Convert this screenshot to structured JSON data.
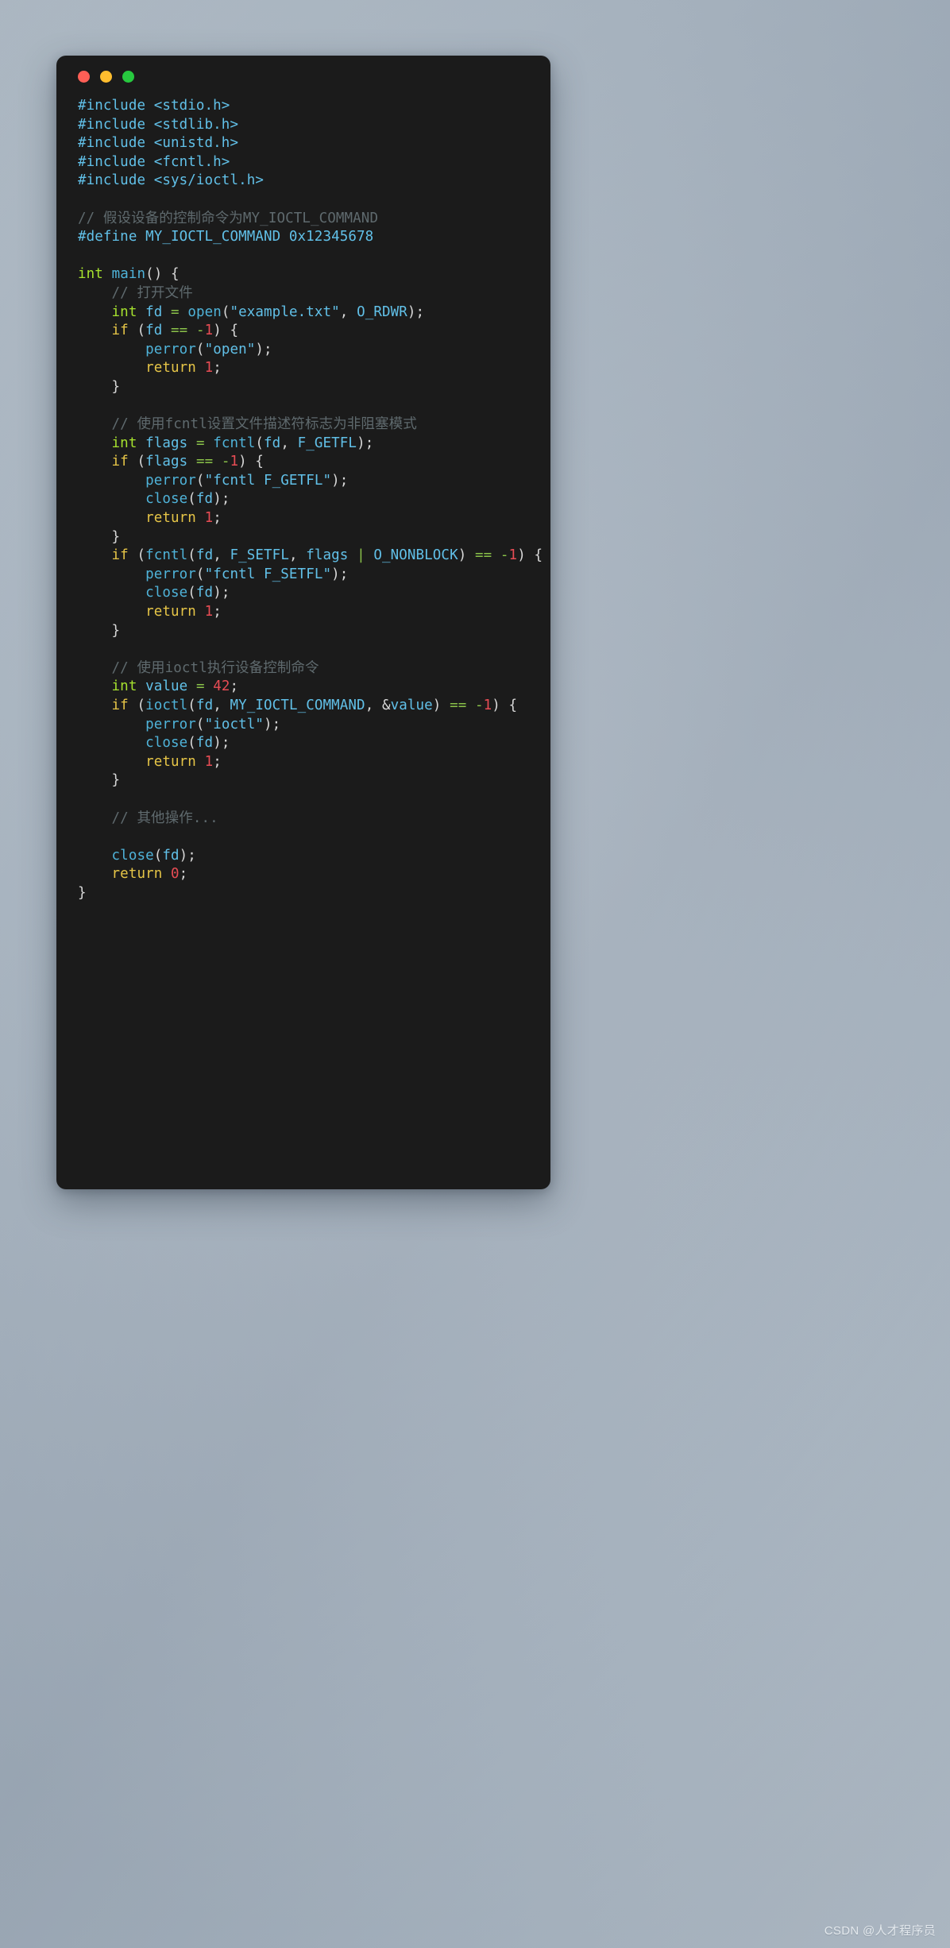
{
  "window": {
    "traffic_lights": [
      {
        "name": "close",
        "color": "#ff5f56"
      },
      {
        "name": "minimize",
        "color": "#ffbd2e"
      },
      {
        "name": "maximize",
        "color": "#27c93f"
      }
    ],
    "background_color": "#1b1b1b"
  },
  "theme": {
    "page_background": "#a8b4c0",
    "comment": "#5f6a6e",
    "keyword": "#e6c547",
    "type": "#a6e22e",
    "operator": "#8bc34a",
    "identifier": "#61c0e8",
    "string": "#61c0e8",
    "number": "#e74c54",
    "punctuation": "#d8d8d8"
  },
  "watermark": {
    "text": "CSDN @人才程序员"
  },
  "code": {
    "language": "c",
    "lines": [
      [
        {
          "t": "pre",
          "v": "#include <stdio.h>"
        }
      ],
      [
        {
          "t": "pre",
          "v": "#include <stdlib.h>"
        }
      ],
      [
        {
          "t": "pre",
          "v": "#include <unistd.h>"
        }
      ],
      [
        {
          "t": "pre",
          "v": "#include <fcntl.h>"
        }
      ],
      [
        {
          "t": "pre",
          "v": "#include <sys/ioctl.h>"
        }
      ],
      [],
      [
        {
          "t": "cmt",
          "v": "// 假设设备的控制命令为MY_IOCTL_COMMAND"
        }
      ],
      [
        {
          "t": "pre",
          "v": "#define MY_IOCTL_COMMAND 0x12345678"
        }
      ],
      [],
      [
        {
          "t": "type",
          "v": "int"
        },
        {
          "t": "punct",
          "v": " "
        },
        {
          "t": "fn",
          "v": "main"
        },
        {
          "t": "punct",
          "v": "() {"
        }
      ],
      [
        {
          "t": "punct",
          "v": "    "
        },
        {
          "t": "cmt",
          "v": "// 打开文件"
        }
      ],
      [
        {
          "t": "punct",
          "v": "    "
        },
        {
          "t": "type",
          "v": "int"
        },
        {
          "t": "punct",
          "v": " "
        },
        {
          "t": "id",
          "v": "fd"
        },
        {
          "t": "punct",
          "v": " "
        },
        {
          "t": "op",
          "v": "="
        },
        {
          "t": "punct",
          "v": " "
        },
        {
          "t": "fn",
          "v": "open"
        },
        {
          "t": "punct",
          "v": "("
        },
        {
          "t": "str",
          "v": "\"example.txt\""
        },
        {
          "t": "punct",
          "v": ", "
        },
        {
          "t": "id",
          "v": "O_RDWR"
        },
        {
          "t": "punct",
          "v": ");"
        }
      ],
      [
        {
          "t": "punct",
          "v": "    "
        },
        {
          "t": "kw",
          "v": "if"
        },
        {
          "t": "punct",
          "v": " ("
        },
        {
          "t": "id",
          "v": "fd"
        },
        {
          "t": "punct",
          "v": " "
        },
        {
          "t": "op",
          "v": "=="
        },
        {
          "t": "punct",
          "v": " "
        },
        {
          "t": "op",
          "v": "-"
        },
        {
          "t": "num",
          "v": "1"
        },
        {
          "t": "punct",
          "v": ") {"
        }
      ],
      [
        {
          "t": "punct",
          "v": "        "
        },
        {
          "t": "fn",
          "v": "perror"
        },
        {
          "t": "punct",
          "v": "("
        },
        {
          "t": "str",
          "v": "\"open\""
        },
        {
          "t": "punct",
          "v": ");"
        }
      ],
      [
        {
          "t": "punct",
          "v": "        "
        },
        {
          "t": "kw",
          "v": "return"
        },
        {
          "t": "punct",
          "v": " "
        },
        {
          "t": "num",
          "v": "1"
        },
        {
          "t": "punct",
          "v": ";"
        }
      ],
      [
        {
          "t": "punct",
          "v": "    }"
        }
      ],
      [],
      [
        {
          "t": "punct",
          "v": "    "
        },
        {
          "t": "cmt",
          "v": "// 使用fcntl设置文件描述符标志为非阻塞模式"
        }
      ],
      [
        {
          "t": "punct",
          "v": "    "
        },
        {
          "t": "type",
          "v": "int"
        },
        {
          "t": "punct",
          "v": " "
        },
        {
          "t": "id",
          "v": "flags"
        },
        {
          "t": "punct",
          "v": " "
        },
        {
          "t": "op",
          "v": "="
        },
        {
          "t": "punct",
          "v": " "
        },
        {
          "t": "fn",
          "v": "fcntl"
        },
        {
          "t": "punct",
          "v": "("
        },
        {
          "t": "id",
          "v": "fd"
        },
        {
          "t": "punct",
          "v": ", "
        },
        {
          "t": "id",
          "v": "F_GETFL"
        },
        {
          "t": "punct",
          "v": ");"
        }
      ],
      [
        {
          "t": "punct",
          "v": "    "
        },
        {
          "t": "kw",
          "v": "if"
        },
        {
          "t": "punct",
          "v": " ("
        },
        {
          "t": "id",
          "v": "flags"
        },
        {
          "t": "punct",
          "v": " "
        },
        {
          "t": "op",
          "v": "=="
        },
        {
          "t": "punct",
          "v": " "
        },
        {
          "t": "op",
          "v": "-"
        },
        {
          "t": "num",
          "v": "1"
        },
        {
          "t": "punct",
          "v": ") {"
        }
      ],
      [
        {
          "t": "punct",
          "v": "        "
        },
        {
          "t": "fn",
          "v": "perror"
        },
        {
          "t": "punct",
          "v": "("
        },
        {
          "t": "str",
          "v": "\"fcntl F_GETFL\""
        },
        {
          "t": "punct",
          "v": ");"
        }
      ],
      [
        {
          "t": "punct",
          "v": "        "
        },
        {
          "t": "fn",
          "v": "close"
        },
        {
          "t": "punct",
          "v": "("
        },
        {
          "t": "id",
          "v": "fd"
        },
        {
          "t": "punct",
          "v": ");"
        }
      ],
      [
        {
          "t": "punct",
          "v": "        "
        },
        {
          "t": "kw",
          "v": "return"
        },
        {
          "t": "punct",
          "v": " "
        },
        {
          "t": "num",
          "v": "1"
        },
        {
          "t": "punct",
          "v": ";"
        }
      ],
      [
        {
          "t": "punct",
          "v": "    }"
        }
      ],
      [
        {
          "t": "punct",
          "v": "    "
        },
        {
          "t": "kw",
          "v": "if"
        },
        {
          "t": "punct",
          "v": " ("
        },
        {
          "t": "fn",
          "v": "fcntl"
        },
        {
          "t": "punct",
          "v": "("
        },
        {
          "t": "id",
          "v": "fd"
        },
        {
          "t": "punct",
          "v": ", "
        },
        {
          "t": "id",
          "v": "F_SETFL"
        },
        {
          "t": "punct",
          "v": ", "
        },
        {
          "t": "id",
          "v": "flags"
        },
        {
          "t": "punct",
          "v": " "
        },
        {
          "t": "op",
          "v": "|"
        },
        {
          "t": "punct",
          "v": " "
        },
        {
          "t": "id",
          "v": "O_NONBLOCK"
        },
        {
          "t": "punct",
          "v": ") "
        },
        {
          "t": "op",
          "v": "=="
        },
        {
          "t": "punct",
          "v": " "
        },
        {
          "t": "op",
          "v": "-"
        },
        {
          "t": "num",
          "v": "1"
        },
        {
          "t": "punct",
          "v": ") {"
        }
      ],
      [
        {
          "t": "punct",
          "v": "        "
        },
        {
          "t": "fn",
          "v": "perror"
        },
        {
          "t": "punct",
          "v": "("
        },
        {
          "t": "str",
          "v": "\"fcntl F_SETFL\""
        },
        {
          "t": "punct",
          "v": ");"
        }
      ],
      [
        {
          "t": "punct",
          "v": "        "
        },
        {
          "t": "fn",
          "v": "close"
        },
        {
          "t": "punct",
          "v": "("
        },
        {
          "t": "id",
          "v": "fd"
        },
        {
          "t": "punct",
          "v": ");"
        }
      ],
      [
        {
          "t": "punct",
          "v": "        "
        },
        {
          "t": "kw",
          "v": "return"
        },
        {
          "t": "punct",
          "v": " "
        },
        {
          "t": "num",
          "v": "1"
        },
        {
          "t": "punct",
          "v": ";"
        }
      ],
      [
        {
          "t": "punct",
          "v": "    }"
        }
      ],
      [],
      [
        {
          "t": "punct",
          "v": "    "
        },
        {
          "t": "cmt",
          "v": "// 使用ioctl执行设备控制命令"
        }
      ],
      [
        {
          "t": "punct",
          "v": "    "
        },
        {
          "t": "type",
          "v": "int"
        },
        {
          "t": "punct",
          "v": " "
        },
        {
          "t": "id",
          "v": "value"
        },
        {
          "t": "punct",
          "v": " "
        },
        {
          "t": "op",
          "v": "="
        },
        {
          "t": "punct",
          "v": " "
        },
        {
          "t": "num",
          "v": "42"
        },
        {
          "t": "punct",
          "v": ";"
        }
      ],
      [
        {
          "t": "punct",
          "v": "    "
        },
        {
          "t": "kw",
          "v": "if"
        },
        {
          "t": "punct",
          "v": " ("
        },
        {
          "t": "fn",
          "v": "ioctl"
        },
        {
          "t": "punct",
          "v": "("
        },
        {
          "t": "id",
          "v": "fd"
        },
        {
          "t": "punct",
          "v": ", "
        },
        {
          "t": "id",
          "v": "MY_IOCTL_COMMAND"
        },
        {
          "t": "punct",
          "v": ", &"
        },
        {
          "t": "id",
          "v": "value"
        },
        {
          "t": "punct",
          "v": ") "
        },
        {
          "t": "op",
          "v": "=="
        },
        {
          "t": "punct",
          "v": " "
        },
        {
          "t": "op",
          "v": "-"
        },
        {
          "t": "num",
          "v": "1"
        },
        {
          "t": "punct",
          "v": ") {"
        }
      ],
      [
        {
          "t": "punct",
          "v": "        "
        },
        {
          "t": "fn",
          "v": "perror"
        },
        {
          "t": "punct",
          "v": "("
        },
        {
          "t": "str",
          "v": "\"ioctl\""
        },
        {
          "t": "punct",
          "v": ");"
        }
      ],
      [
        {
          "t": "punct",
          "v": "        "
        },
        {
          "t": "fn",
          "v": "close"
        },
        {
          "t": "punct",
          "v": "("
        },
        {
          "t": "id",
          "v": "fd"
        },
        {
          "t": "punct",
          "v": ");"
        }
      ],
      [
        {
          "t": "punct",
          "v": "        "
        },
        {
          "t": "kw",
          "v": "return"
        },
        {
          "t": "punct",
          "v": " "
        },
        {
          "t": "num",
          "v": "1"
        },
        {
          "t": "punct",
          "v": ";"
        }
      ],
      [
        {
          "t": "punct",
          "v": "    }"
        }
      ],
      [],
      [
        {
          "t": "punct",
          "v": "    "
        },
        {
          "t": "cmt",
          "v": "// 其他操作..."
        }
      ],
      [],
      [
        {
          "t": "punct",
          "v": "    "
        },
        {
          "t": "fn",
          "v": "close"
        },
        {
          "t": "punct",
          "v": "("
        },
        {
          "t": "id",
          "v": "fd"
        },
        {
          "t": "punct",
          "v": ");"
        }
      ],
      [
        {
          "t": "punct",
          "v": "    "
        },
        {
          "t": "kw",
          "v": "return"
        },
        {
          "t": "punct",
          "v": " "
        },
        {
          "t": "num",
          "v": "0"
        },
        {
          "t": "punct",
          "v": ";"
        }
      ],
      [
        {
          "t": "punct",
          "v": "}"
        }
      ]
    ]
  }
}
